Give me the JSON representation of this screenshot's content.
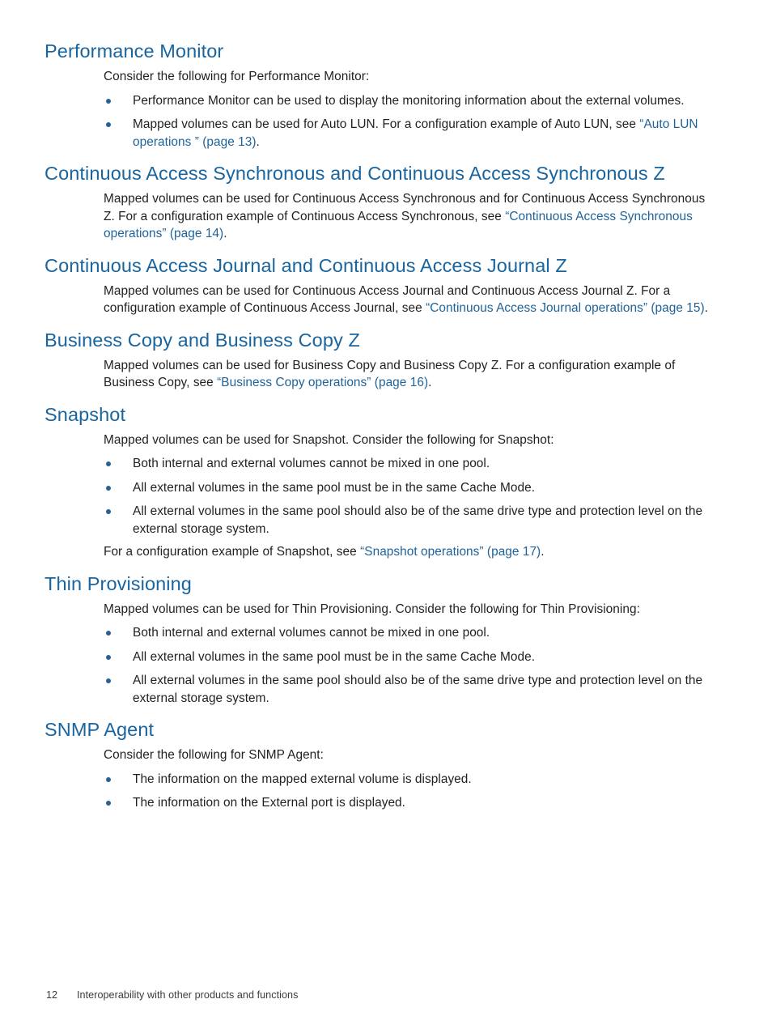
{
  "page": {
    "footer_page_number": "12",
    "footer_chapter": "Interoperability with other products and functions",
    "heading_color": "#19659f",
    "link_color": "#1f6399",
    "bullet_color": "#2b5f93",
    "body_color": "#231f20"
  },
  "sections": [
    {
      "id": "performance-monitor",
      "heading": "Performance Monitor",
      "intro": "Consider the following for Performance Monitor:",
      "bullets": [
        {
          "text_before": "Performance Monitor can be used to display the monitoring information about the external volumes.",
          "link": "",
          "text_after": ""
        },
        {
          "text_before": "Mapped volumes can be used for Auto LUN. For a configuration example of Auto LUN, see ",
          "link": "“Auto LUN operations ” (page 13)",
          "text_after": "."
        }
      ],
      "outro": ""
    },
    {
      "id": "continuous-access-synchronous",
      "heading": "Continuous Access Synchronous and Continuous Access Synchronous Z",
      "para_before": "Mapped volumes can be used for Continuous Access Synchronous and for Continuous Access Synchronous Z. For a configuration example of Continuous Access Synchronous, see ",
      "para_link": "“Continuous Access Synchronous operations” (page 14)",
      "para_after": "."
    },
    {
      "id": "continuous-access-journal",
      "heading": "Continuous Access Journal and Continuous Access Journal Z",
      "para_before": "Mapped volumes can be used for Continuous Access Journal and Continuous Access Journal Z. For a configuration example of Continuous Access Journal, see ",
      "para_link": "“Continuous Access Journal operations” (page 15)",
      "para_after": "."
    },
    {
      "id": "business-copy",
      "heading": "Business Copy and Business Copy Z",
      "para_before": "Mapped volumes can be used for Business Copy and Business Copy Z. For a configuration example of Business Copy, see ",
      "para_link": "“Business Copy operations” (page 16)",
      "para_after": "."
    },
    {
      "id": "snapshot",
      "heading": "Snapshot",
      "intro": "Mapped volumes can be used for Snapshot. Consider the following for Snapshot:",
      "bullets": [
        "Both internal and external volumes cannot be mixed in one pool.",
        "All external volumes in the same pool must be in the same Cache Mode.",
        "All external volumes in the same pool should also be of the same drive type and protection level on the external storage system."
      ],
      "outro_before": "For a configuration example of Snapshot, see ",
      "outro_link": "“Snapshot operations” (page 17)",
      "outro_after": "."
    },
    {
      "id": "thin-provisioning",
      "heading": "Thin Provisioning",
      "intro": "Mapped volumes can be used for Thin Provisioning. Consider the following for Thin Provisioning:",
      "bullets": [
        "Both internal and external volumes cannot be mixed in one pool.",
        "All external volumes in the same pool must be in the same Cache Mode.",
        "All external volumes in the same pool should also be of the same drive type and protection level on the external storage system."
      ]
    },
    {
      "id": "snmp-agent",
      "heading": "SNMP Agent",
      "intro": "Consider the following for SNMP Agent:",
      "bullets": [
        "The information on the mapped external volume is displayed.",
        "The information on the External port is displayed."
      ]
    }
  ]
}
